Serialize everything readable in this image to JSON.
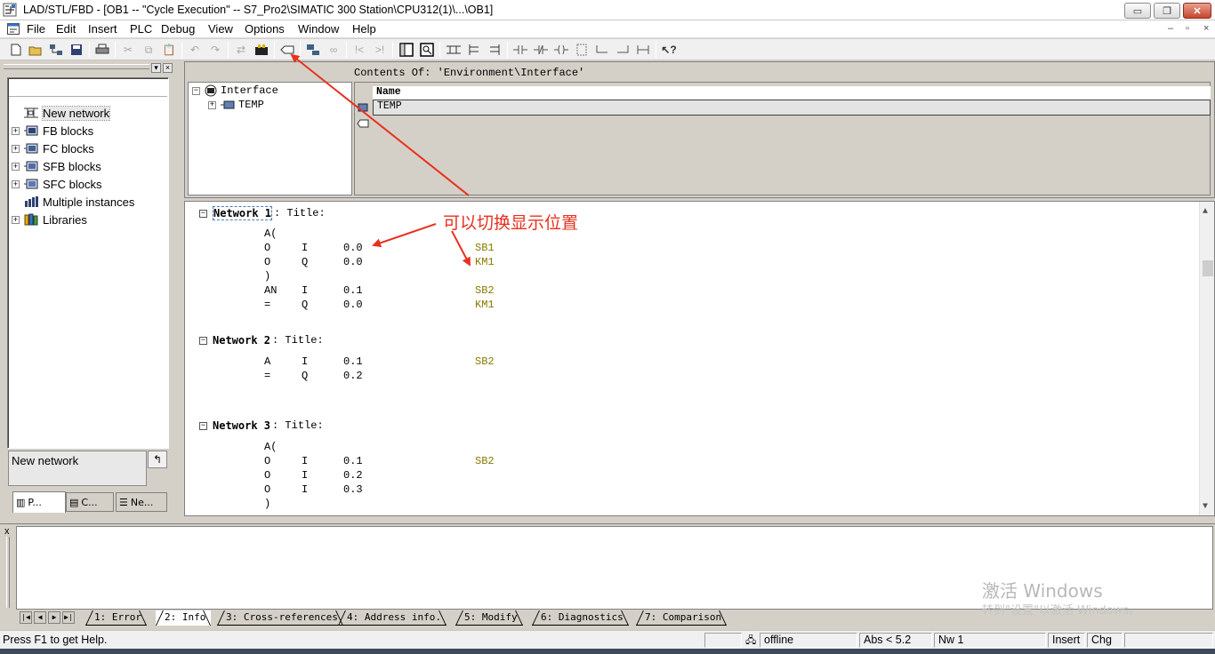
{
  "window": {
    "title": "LAD/STL/FBD  - [OB1 -- \"Cycle Execution\" -- S7_Pro2\\SIMATIC 300 Station\\CPU312(1)\\...\\OB1]",
    "min_label": "▭",
    "max_label": "❐",
    "close_label": "✕"
  },
  "menu": {
    "items": [
      "File",
      "Edit",
      "Insert",
      "PLC",
      "Debug",
      "View",
      "Options",
      "Window",
      "Help"
    ],
    "mdi": [
      "–",
      "▫",
      "×"
    ]
  },
  "toolbar": {
    "icons": [
      "new-icon",
      "open-icon",
      "network-icon",
      "save-icon",
      "print-icon",
      "cut-icon",
      "copy-icon",
      "paste-icon",
      "undo-icon",
      "redo-icon",
      "online-icon",
      "download-icon",
      "toggle-position-icon",
      "monitor-icon",
      "glasses-icon",
      "break-icon",
      "overview-icon",
      "detail-icon",
      "new-network-icon",
      "branch-icon",
      "contact-icon",
      "nc-contact-icon",
      "coil-icon",
      "box-icon",
      "open-branch-icon",
      "close-branch-icon",
      "connection-icon",
      "help-icon"
    ]
  },
  "catalog": {
    "items": [
      {
        "label": "New network",
        "expandable": false,
        "selected": true,
        "icon": "new-network-icon"
      },
      {
        "label": "FB blocks",
        "expandable": true,
        "icon": "fb-blocks-icon"
      },
      {
        "label": "FC blocks",
        "expandable": true,
        "icon": "fc-blocks-icon"
      },
      {
        "label": "SFB blocks",
        "expandable": true,
        "icon": "sfb-blocks-icon"
      },
      {
        "label": "SFC blocks",
        "expandable": true,
        "icon": "sfc-blocks-icon"
      },
      {
        "label": "Multiple instances",
        "expandable": false,
        "icon": "multiple-instances-icon"
      },
      {
        "label": "Libraries",
        "expandable": true,
        "icon": "libraries-icon"
      }
    ],
    "info_text": "New network",
    "tabs": [
      "P...",
      "C...",
      "Ne..."
    ]
  },
  "interface": {
    "contents_title": "Contents Of: 'Environment\\Interface'",
    "tree": [
      {
        "label": "Interface",
        "expanded": true
      },
      {
        "label": "TEMP",
        "expanded": false
      }
    ],
    "column_header": "Name",
    "rows": [
      "TEMP"
    ]
  },
  "editor": {
    "networks": [
      {
        "label": "Network 1",
        "title": ": Title:",
        "lines": [
          {
            "op": "A(",
            "operand": "",
            "address": "",
            "symbol": ""
          },
          {
            "op": "O",
            "operand": "I",
            "address": "0.0",
            "symbol": "SB1"
          },
          {
            "op": "O",
            "operand": "Q",
            "address": "0.0",
            "symbol": "KM1"
          },
          {
            "op": ")",
            "operand": "",
            "address": "",
            "symbol": ""
          },
          {
            "op": "AN",
            "operand": "I",
            "address": "0.1",
            "symbol": "SB2"
          },
          {
            "op": "=",
            "operand": "Q",
            "address": "0.0",
            "symbol": "KM1"
          }
        ]
      },
      {
        "label": "Network 2",
        "title": ": Title:",
        "lines": [
          {
            "op": "A",
            "operand": "I",
            "address": "0.1",
            "symbol": "SB2"
          },
          {
            "op": "=",
            "operand": "Q",
            "address": "0.2",
            "symbol": ""
          }
        ]
      },
      {
        "label": "Network 3",
        "title": ": Title:",
        "lines": [
          {
            "op": "A(",
            "operand": "",
            "address": "",
            "symbol": ""
          },
          {
            "op": "O",
            "operand": "I",
            "address": "0.1",
            "symbol": "SB2"
          },
          {
            "op": "O",
            "operand": "I",
            "address": "0.2",
            "symbol": ""
          },
          {
            "op": "O",
            "operand": "I",
            "address": "0.3",
            "symbol": ""
          },
          {
            "op": ")",
            "operand": "",
            "address": "",
            "symbol": ""
          }
        ]
      }
    ]
  },
  "annotation": {
    "text": "可以切换显示位置",
    "color": "#e8311f"
  },
  "output": {
    "close_label": "x",
    "tabs": [
      "1: Error",
      "2: Info",
      "3: Cross-references",
      "4: Address info.",
      "5: Modify",
      "6: Diagnostics",
      "7: Comparison"
    ],
    "active_tab": 1
  },
  "watermark": {
    "line1": "激活 Windows",
    "line2": "转到\"设置\"以激活 Windows。"
  },
  "status": {
    "help": "Press F1 to get Help.",
    "mode": "offline",
    "abs": "Abs < 5.2",
    "nw": "Nw 1",
    "insert": "Insert",
    "chg": "Chg"
  },
  "colors": {
    "symbol": "#8a7a00",
    "panel": "#d4d0c8",
    "annotation": "#e8311f"
  }
}
